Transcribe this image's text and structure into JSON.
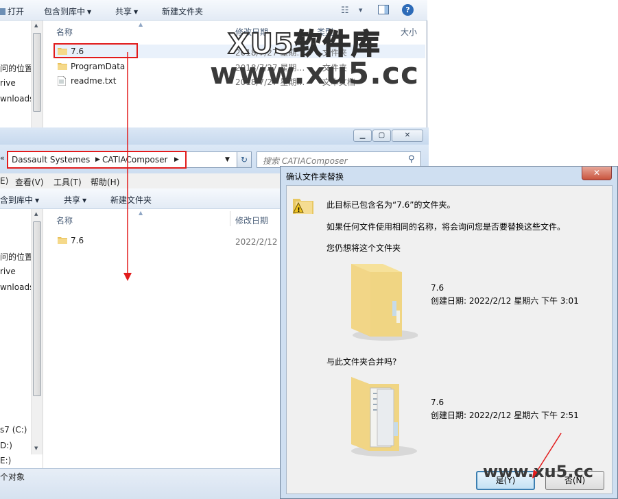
{
  "top_window": {
    "toolbar": {
      "open": "打开",
      "include_library": "包含到库中",
      "share": "共享",
      "new_folder": "新建文件夹"
    },
    "nav_items": [
      "问的位置",
      "rive",
      "wnloads"
    ],
    "columns": {
      "name": "名称",
      "date": "修改日期",
      "type": "类型",
      "size": "大小"
    },
    "files": [
      {
        "name": "7.6",
        "date": "2018/7/27 星期…",
        "type": "文件夹"
      },
      {
        "name": "ProgramData",
        "date": "2018/7/27 星期…",
        "type": "文件夹"
      },
      {
        "name": "readme.txt",
        "date": "2018/7/27 星期…",
        "type": "文本文档"
      }
    ]
  },
  "second_window": {
    "breadcrumb": [
      "Dassault Systemes",
      "CATIAComposer"
    ],
    "search_placeholder": "搜索 CATIAComposer",
    "menu": [
      "E)",
      "查看(V)",
      "工具(T)",
      "帮助(H)"
    ],
    "toolbar": {
      "include_library": "含到库中",
      "share": "共享",
      "new_folder": "新建文件夹"
    },
    "nav_items": [
      "问的位置",
      "rive",
      "wnloads"
    ],
    "drives": [
      "s7 (C:)",
      "D:)",
      "E:)"
    ],
    "columns": {
      "name": "名称",
      "date": "修改日期"
    },
    "files": [
      {
        "name": "7.6",
        "date": "2022/2/12 星"
      }
    ],
    "status": "个对象"
  },
  "dialog": {
    "title": "确认文件夹替换",
    "close_label": "✕",
    "message": "此目标已包含名为“7.6”的文件夹。",
    "hint": "如果任何文件使用相同的名称，将会询问您是否要替换这些文件。",
    "question1": "您仍想将这个文件夹",
    "source": {
      "name": "7.6",
      "created": "创建日期: 2022/2/12 星期六 下午 3:01"
    },
    "question2": "与此文件夹合并吗?",
    "target": {
      "name": "7.6",
      "created": "创建日期: 2022/2/12 星期六 下午 2:51"
    },
    "yes_label": "是(Y)",
    "no_label": "否(N)"
  },
  "watermark": {
    "brand": "XU5软件库",
    "url": "www.xu5.cc",
    "url_bottom": "www.xu5.cc"
  },
  "colors": {
    "annotation_red": "#e21b1b",
    "dialog_frame": "#cfdff1",
    "folder_yellow": "#f2d27a"
  }
}
